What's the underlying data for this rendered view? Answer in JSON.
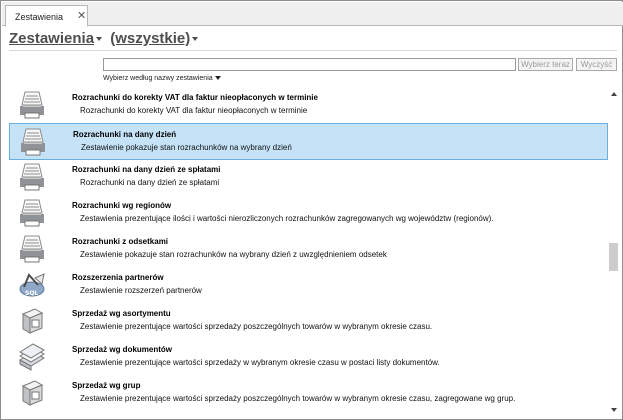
{
  "tab": {
    "label": "Zestawienia",
    "close": "✕"
  },
  "header": {
    "title": "Zestawienia",
    "filter": "(wszystkie)"
  },
  "search": {
    "value": "",
    "select_label": "Wybierz teraz",
    "clear_label": "Wyczyść"
  },
  "sort": {
    "label": "Wybierz według nazwy zestawienia"
  },
  "rows": [
    {
      "title": "Rozrachunki do korekty VAT dla faktur nieopłaconych w terminie",
      "desc": "Rozrachunki do korekty VAT dla faktur nieopłaconych w terminie",
      "icon": "printer-icon"
    },
    {
      "title": "Rozrachunki na dany dzień",
      "desc": "Zestawienie pokazuje stan rozrachunków na wybrany dzień",
      "icon": "printer-icon"
    },
    {
      "title": "Rozrachunki na dany dzień ze spłatami",
      "desc": "Rozrachunki na dany dzień ze spłatami",
      "icon": "printer-icon"
    },
    {
      "title": "Rozrachunki wg regionów",
      "desc": "Zestawienia prezentujące ilości i wartości nierozliczonych rozrachunków zagregowanych wg województw (regionów).",
      "icon": "printer-icon"
    },
    {
      "title": "Rozrachunki z odsetkami",
      "desc": "Zestawienie pokazuje stan rozrachunków na wybrany dzień z uwzględnieniem odsetek",
      "icon": "printer-icon"
    },
    {
      "title": "Rozszerzenia partnerów",
      "desc": "Zestawienie rozszerzeń partnerów",
      "icon": "sql-icon"
    },
    {
      "title": "Sprzedaż wg asortymentu",
      "desc": "Zestawienie prezentujące wartości sprzedaży poszczególnych towarów w wybranym okresie czasu.",
      "icon": "box-icon"
    },
    {
      "title": "Sprzedaż wg dokumentów",
      "desc": "Zestawienie prezentujące wartości sprzedaży w wybranym okresie czasu w postaci listy dokumentów.",
      "icon": "documents-icon"
    },
    {
      "title": "Sprzedaż wg grup",
      "desc": "Zestawienie prezentujące wartości sprzedaży poszczególnych towarów w wybranym okresie czasu, zagregowane wg grup.",
      "icon": "box-icon"
    }
  ],
  "selected_index": 1
}
